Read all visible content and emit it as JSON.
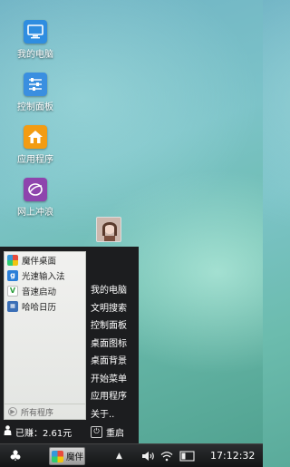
{
  "desktop": {
    "icons": [
      {
        "label": "我的电脑",
        "icon": "computer-icon",
        "color": "#2f8de0"
      },
      {
        "label": "控制面板",
        "icon": "control-panel-icon",
        "color": "#3a8fe0"
      },
      {
        "label": "应用程序",
        "icon": "home-icon",
        "color": "#f39c12"
      },
      {
        "label": "网上冲浪",
        "icon": "browser-icon",
        "color": "#8e44ad"
      }
    ]
  },
  "start_menu": {
    "pinned": [
      {
        "label": "魔伴桌面",
        "icon": "mobang-icon"
      },
      {
        "label": "光速输入法",
        "icon": "input-method-icon"
      },
      {
        "label": "音速启动",
        "icon": "vstart-icon"
      },
      {
        "label": "哈哈日历",
        "icon": "calendar-icon"
      }
    ],
    "all_programs": "所有程序",
    "right_items": [
      "我的电脑",
      "文明搜索",
      "控制面板",
      "桌面图标",
      "桌面背景",
      "开始菜单",
      "应用程序",
      "关于.."
    ],
    "earnings": "已赚：2.61元",
    "restart": "重启"
  },
  "taskbar": {
    "task_label": "魔伴",
    "clock": "17:12:32"
  }
}
